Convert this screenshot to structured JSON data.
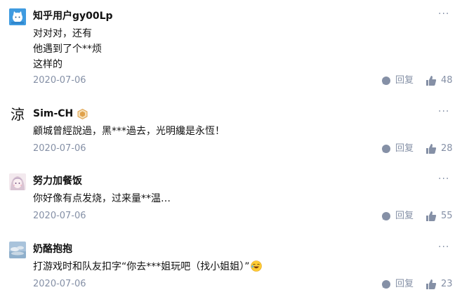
{
  "colors": {
    "meta": "#8590a6",
    "text": "#121212",
    "badge": "#e0a14a"
  },
  "comments": [
    {
      "author": "知乎用户gy00Lp",
      "avatar_icon": "blue-cat-avatar",
      "lines": [
        "对对对，还有",
        "他遇到了个**烦",
        "这样的"
      ],
      "date": "2020-07-06",
      "reply_label": "回复",
      "likes": "48",
      "more": "···"
    },
    {
      "author": "Sim-CH",
      "avatar_char": "涼",
      "badge_icon": "gold-badge-icon",
      "lines": [
        "顧城曾經說過，黑***過去，光明纔是永恆！"
      ],
      "date": "2020-07-06",
      "reply_label": "回复",
      "likes": "28",
      "more": "···"
    },
    {
      "author": "努力加餐饭",
      "avatar_icon": "anime-girl-avatar",
      "lines": [
        "你好像有点发烧，过来量**温…"
      ],
      "date": "2020-07-06",
      "reply_label": "回复",
      "likes": "55",
      "more": "···"
    },
    {
      "author": "奶酪抱抱",
      "avatar_icon": "sky-clouds-avatar",
      "lines": [
        "打游戏时和队友扣字“你去***姐玩吧（找小姐姐）”"
      ],
      "emoji_icon": "laughing-emoji",
      "date": "2020-07-06",
      "reply_label": "回复",
      "likes": "23",
      "more": "···"
    }
  ]
}
